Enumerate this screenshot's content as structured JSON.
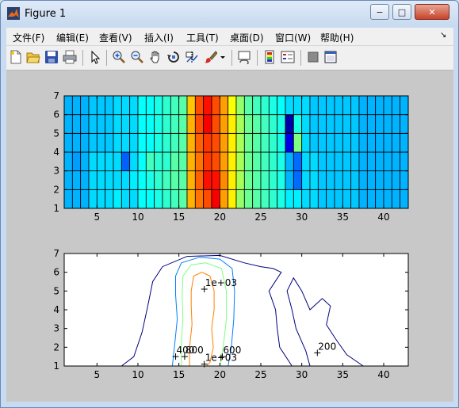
{
  "window": {
    "title": "Figure 1",
    "min_label": "−",
    "max_label": "□",
    "close_label": "✕"
  },
  "menu": {
    "items": [
      "文件(F)",
      "编辑(E)",
      "查看(V)",
      "插入(I)",
      "工具(T)",
      "桌面(D)",
      "窗口(W)",
      "帮助(H)"
    ],
    "dock_arrow": "↘"
  },
  "toolbar": {
    "icons": [
      "new-figure-icon",
      "open-file-icon",
      "save-icon",
      "print-icon",
      "pointer-icon",
      "zoom-in-icon",
      "zoom-out-icon",
      "pan-hand-icon",
      "rotate-3d-icon",
      "data-cursor-icon",
      "brush-icon",
      "link-plot-icon",
      "colorbar-icon",
      "legend-icon",
      "hide-tools-icon",
      "show-tools-icon"
    ]
  },
  "chart_data": [
    {
      "type": "heatmap",
      "title": "",
      "x_ticks": [
        5,
        10,
        15,
        20,
        25,
        30,
        35,
        40
      ],
      "y_ticks": [
        1,
        2,
        3,
        4,
        5,
        6,
        7
      ],
      "xlim": [
        1,
        43
      ],
      "ylim": [
        1,
        7
      ],
      "colormap": "jet",
      "color_range": [
        0,
        1000
      ],
      "grid": [
        [
          300,
          300,
          300,
          340,
          340,
          340,
          360,
          340,
          340,
          380,
          380,
          400,
          420,
          440,
          460,
          700,
          760,
          800,
          880,
          720,
          640,
          520,
          480,
          460,
          440,
          420,
          400,
          360,
          360,
          340,
          340,
          320,
          320,
          320,
          320,
          320,
          300,
          300,
          300,
          300,
          300,
          300
        ],
        [
          300,
          300,
          300,
          340,
          340,
          340,
          340,
          340,
          360,
          380,
          400,
          420,
          440,
          460,
          460,
          700,
          780,
          860,
          860,
          740,
          640,
          540,
          480,
          460,
          440,
          420,
          400,
          300,
          230,
          340,
          340,
          320,
          320,
          320,
          320,
          320,
          300,
          300,
          300,
          300,
          300,
          300
        ],
        [
          300,
          280,
          300,
          340,
          340,
          340,
          340,
          220,
          340,
          380,
          440,
          420,
          420,
          460,
          460,
          700,
          760,
          820,
          800,
          720,
          640,
          540,
          480,
          460,
          440,
          420,
          400,
          300,
          230,
          340,
          340,
          320,
          320,
          320,
          320,
          320,
          300,
          300,
          300,
          300,
          300,
          300
        ],
        [
          300,
          300,
          300,
          320,
          320,
          320,
          340,
          340,
          340,
          380,
          380,
          400,
          420,
          440,
          460,
          700,
          780,
          820,
          800,
          720,
          640,
          540,
          480,
          460,
          440,
          420,
          400,
          100,
          500,
          340,
          320,
          320,
          320,
          320,
          320,
          320,
          300,
          300,
          300,
          300,
          300,
          300
        ],
        [
          300,
          300,
          300,
          320,
          320,
          320,
          340,
          340,
          340,
          380,
          380,
          400,
          420,
          440,
          460,
          700,
          800,
          880,
          800,
          720,
          640,
          540,
          480,
          460,
          440,
          420,
          400,
          40,
          400,
          340,
          320,
          320,
          320,
          320,
          320,
          320,
          300,
          300,
          300,
          300,
          300,
          300
        ],
        [
          300,
          300,
          300,
          320,
          320,
          320,
          340,
          340,
          340,
          380,
          380,
          400,
          420,
          440,
          460,
          680,
          800,
          860,
          800,
          720,
          620,
          520,
          460,
          440,
          420,
          400,
          380,
          340,
          340,
          340,
          320,
          320,
          320,
          320,
          320,
          320,
          300,
          300,
          300,
          300,
          300,
          300
        ]
      ]
    },
    {
      "type": "contour",
      "title": "",
      "x_ticks": [
        5,
        10,
        15,
        20,
        25,
        30,
        35,
        40
      ],
      "y_ticks": [
        1,
        2,
        3,
        4,
        5,
        6,
        7
      ],
      "xlim": [
        1,
        43
      ],
      "ylim": [
        1,
        7
      ],
      "levels": [
        200,
        400,
        600,
        800,
        1000
      ],
      "level_colors": [
        "#00007f",
        "#0080ff",
        "#7fff7f",
        "#ff8000",
        "#7f0000"
      ],
      "labels": [
        {
          "text": "1e+03",
          "x": 18.1,
          "y": 5.1
        },
        {
          "text": "400",
          "x": 14.6,
          "y": 1.5
        },
        {
          "text": "800",
          "x": 15.7,
          "y": 1.5
        },
        {
          "text": "600",
          "x": 20.3,
          "y": 1.5
        },
        {
          "text": "1e+03",
          "x": 18.1,
          "y": 1.1
        },
        {
          "text": "200",
          "x": 31.9,
          "y": 1.7
        }
      ],
      "paths": [
        {
          "level": 200,
          "points": [
            [
              8,
              1
            ],
            [
              9.5,
              1.5
            ],
            [
              10.5,
              2.8
            ],
            [
              11.2,
              4.2
            ],
            [
              11.8,
              5.5
            ],
            [
              13,
              6.3
            ],
            [
              16,
              6.85
            ],
            [
              20,
              6.9
            ],
            [
              23,
              6.5
            ],
            [
              25,
              6.3
            ],
            [
              26.5,
              6.2
            ],
            [
              27.5,
              6.0
            ],
            [
              26,
              5.0
            ],
            [
              26.8,
              4.0
            ],
            [
              27,
              3.0
            ],
            [
              27.3,
              2.0
            ],
            [
              28.8,
              1.0
            ]
          ]
        },
        {
          "level": 200,
          "points": [
            [
              37.5,
              1
            ],
            [
              35.5,
              1.6
            ],
            [
              34.2,
              2.4
            ],
            [
              33,
              3.2
            ],
            [
              33.5,
              4.2
            ],
            [
              32.5,
              4.6
            ],
            [
              31,
              4.0
            ],
            [
              30,
              5.0
            ],
            [
              29,
              5.7
            ],
            [
              28.2,
              5.0
            ],
            [
              28.8,
              4.0
            ],
            [
              29.3,
              3.0
            ],
            [
              30.5,
              1.8
            ],
            [
              31,
              1
            ]
          ]
        },
        {
          "level": 400,
          "points": [
            [
              14.2,
              1
            ],
            [
              14.5,
              2.2
            ],
            [
              14.8,
              3.5
            ],
            [
              14.6,
              4.8
            ],
            [
              14.6,
              5.8
            ],
            [
              15.3,
              6.5
            ],
            [
              17.5,
              6.8
            ],
            [
              20,
              6.7
            ],
            [
              21.5,
              6.2
            ],
            [
              21.8,
              5.0
            ],
            [
              21.7,
              3.5
            ],
            [
              21.4,
              2.0
            ],
            [
              21,
              1
            ]
          ]
        },
        {
          "level": 600,
          "points": [
            [
              15.3,
              1
            ],
            [
              15.3,
              2.3
            ],
            [
              15.5,
              3.5
            ],
            [
              15.4,
              4.8
            ],
            [
              15.5,
              5.8
            ],
            [
              16.5,
              6.4
            ],
            [
              18.3,
              6.5
            ],
            [
              20.2,
              6.2
            ],
            [
              20.8,
              5.0
            ],
            [
              20.8,
              3.5
            ],
            [
              20.4,
              2.0
            ],
            [
              20,
              1
            ]
          ]
        },
        {
          "level": 800,
          "points": [
            [
              16.3,
              1
            ],
            [
              16.3,
              2.0
            ],
            [
              16.6,
              3.2
            ],
            [
              16.5,
              4.2
            ],
            [
              16.5,
              5.0
            ],
            [
              16.8,
              5.8
            ],
            [
              17.8,
              6.0
            ],
            [
              18.8,
              5.8
            ],
            [
              19.3,
              5.0
            ],
            [
              19.3,
              4.0
            ],
            [
              19,
              3.0
            ],
            [
              19.2,
              2.0
            ],
            [
              18.8,
              1.2
            ],
            [
              18.4,
              1
            ]
          ]
        }
      ]
    }
  ]
}
